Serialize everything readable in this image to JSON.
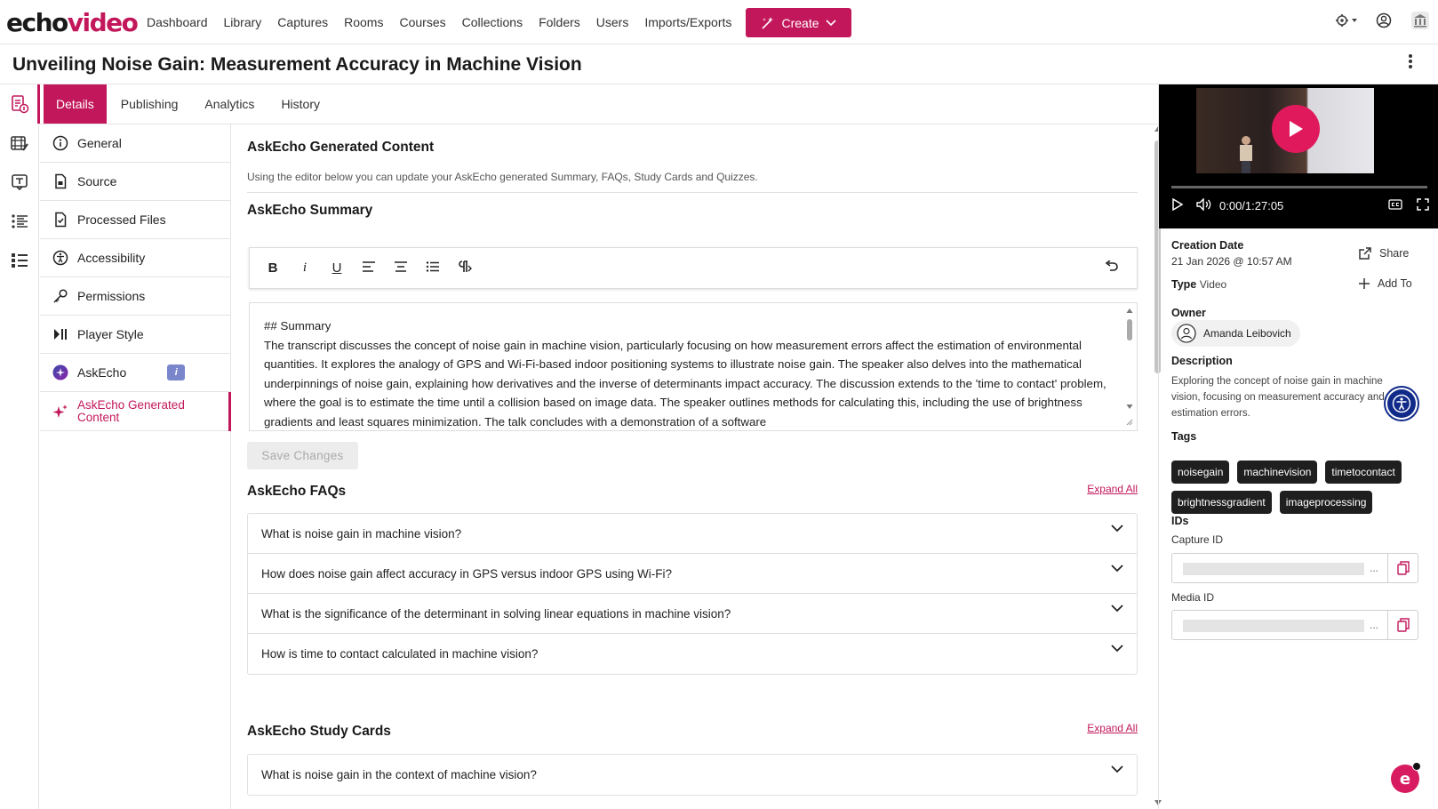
{
  "app": {
    "logo_a": "echo",
    "logo_b": "video"
  },
  "nav": {
    "items": [
      "Dashboard",
      "Library",
      "Captures",
      "Rooms",
      "Courses",
      "Collections",
      "Folders",
      "Users",
      "Imports/Exports"
    ],
    "create_label": "Create"
  },
  "page": {
    "title": "Unveiling Noise Gain: Measurement Accuracy in Machine Vision"
  },
  "tabs": [
    "Details",
    "Publishing",
    "Analytics",
    "History"
  ],
  "submenu": {
    "general": "General",
    "source": "Source",
    "processed": "Processed Files",
    "accessibility": "Accessibility",
    "permissions": "Permissions",
    "player_style": "Player Style",
    "askecho": "AskEcho",
    "askecho_badge": "i",
    "askecho_generated": "AskEcho Generated Content"
  },
  "content": {
    "heading": "AskEcho Generated Content",
    "description": "Using the editor below you can update your AskEcho generated Summary, FAQs, Study Cards and Quizzes.",
    "summary_title": "AskEcho Summary",
    "toolbar": {
      "bold": "B",
      "italic": "i",
      "underline": "U",
      "para": "¶"
    },
    "summary_heading": "## Summary",
    "summary_text": "The transcript discusses the concept of noise gain in machine vision, particularly focusing on how measurement errors affect the estimation of environmental quantities. It explores the analogy of GPS and Wi-Fi-based indoor positioning systems to illustrate noise gain. The speaker also delves into the mathematical underpinnings of noise gain, explaining how derivatives and the inverse of determinants impact accuracy. The discussion extends to the 'time to contact' problem, where the goal is to estimate the time until a collision based on image data. The speaker outlines methods for calculating this, including the use of brightness gradients and least squares minimization. The talk concludes with a demonstration of a software",
    "save_label": "Save Changes",
    "faqs_title": "AskEcho FAQs",
    "expand_all": "Expand All",
    "faqs": [
      "What is noise gain in machine vision?",
      "How does noise gain affect accuracy in GPS versus indoor GPS using Wi-Fi?",
      "What is the significance of the determinant in solving linear equations in machine vision?",
      "How is time to contact calculated in machine vision?"
    ],
    "study_title": "AskEcho Study Cards",
    "study_expand": "Expand All",
    "study_cards": [
      "What is noise gain in the context of machine vision?"
    ]
  },
  "video": {
    "time": "0:00/1:27:05",
    "progress": 0
  },
  "details": {
    "creation_label": "Creation Date",
    "creation_value": "21 Jan 2026 @ 10:57 AM",
    "type_label": "Type",
    "type_value": "Video",
    "share": "Share",
    "add_to": "Add To",
    "owner_label": "Owner",
    "owner_name": "Amanda Leibovich",
    "description_label": "Description",
    "description_text": "Exploring the concept of noise gain in machine vision, focusing on measurement accuracy and estimation errors.",
    "tags_label": "Tags",
    "tags": [
      "noisegain",
      "machinevision",
      "timetocontact",
      "brightnessgradient",
      "imageprocessing"
    ],
    "ids_label": "IDs",
    "capture_id_label": "Capture ID",
    "media_id_label": "Media ID",
    "ellipsis": "..."
  },
  "colors": {
    "brand": "#c2185b",
    "tag_bg": "#1f1f1f"
  }
}
